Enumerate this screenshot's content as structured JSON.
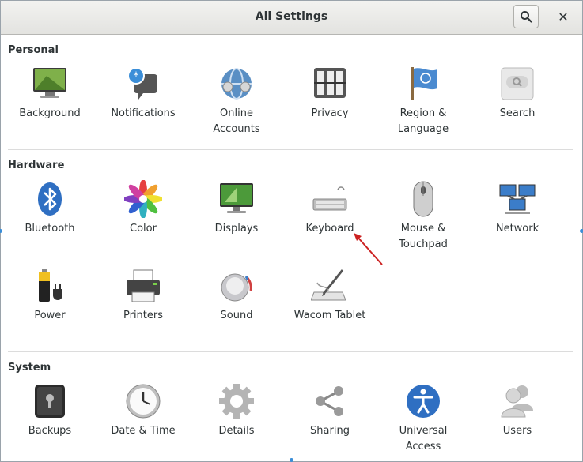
{
  "window": {
    "title": "All Settings"
  },
  "header": {
    "search_icon": "search-icon",
    "close_glyph": "✕"
  },
  "sections": [
    {
      "title": "Personal",
      "items": [
        {
          "label": "Background",
          "icon": "background-icon"
        },
        {
          "label": "Notifications",
          "icon": "notifications-icon"
        },
        {
          "label": "Online\nAccounts",
          "icon": "online-accounts-icon"
        },
        {
          "label": "Privacy",
          "icon": "privacy-icon"
        },
        {
          "label": "Region &\nLanguage",
          "icon": "region-icon"
        },
        {
          "label": "Search",
          "icon": "search-settings-icon"
        }
      ]
    },
    {
      "title": "Hardware",
      "items": [
        {
          "label": "Bluetooth",
          "icon": "bluetooth-icon"
        },
        {
          "label": "Color",
          "icon": "color-icon"
        },
        {
          "label": "Displays",
          "icon": "displays-icon"
        },
        {
          "label": "Keyboard",
          "icon": "keyboard-icon"
        },
        {
          "label": "Mouse &\nTouchpad",
          "icon": "mouse-icon"
        },
        {
          "label": "Network",
          "icon": "network-icon"
        },
        {
          "label": "Power",
          "icon": "power-icon"
        },
        {
          "label": "Printers",
          "icon": "printer-icon"
        },
        {
          "label": "Sound",
          "icon": "sound-icon"
        },
        {
          "label": "Wacom Tablet",
          "icon": "wacom-tablet-icon"
        }
      ]
    },
    {
      "title": "System",
      "items": [
        {
          "label": "Backups",
          "icon": "backups-icon"
        },
        {
          "label": "Date & Time",
          "icon": "clock-icon"
        },
        {
          "label": "Details",
          "icon": "gear-icon"
        },
        {
          "label": "Sharing",
          "icon": "share-icon"
        },
        {
          "label": "Universal\nAccess",
          "icon": "accessibility-icon"
        },
        {
          "label": "Users",
          "icon": "users-icon"
        }
      ]
    }
  ],
  "colors": {
    "accent": "#3b8ed8",
    "annotation_arrow": "#cc2222",
    "text": "#2e3436"
  }
}
